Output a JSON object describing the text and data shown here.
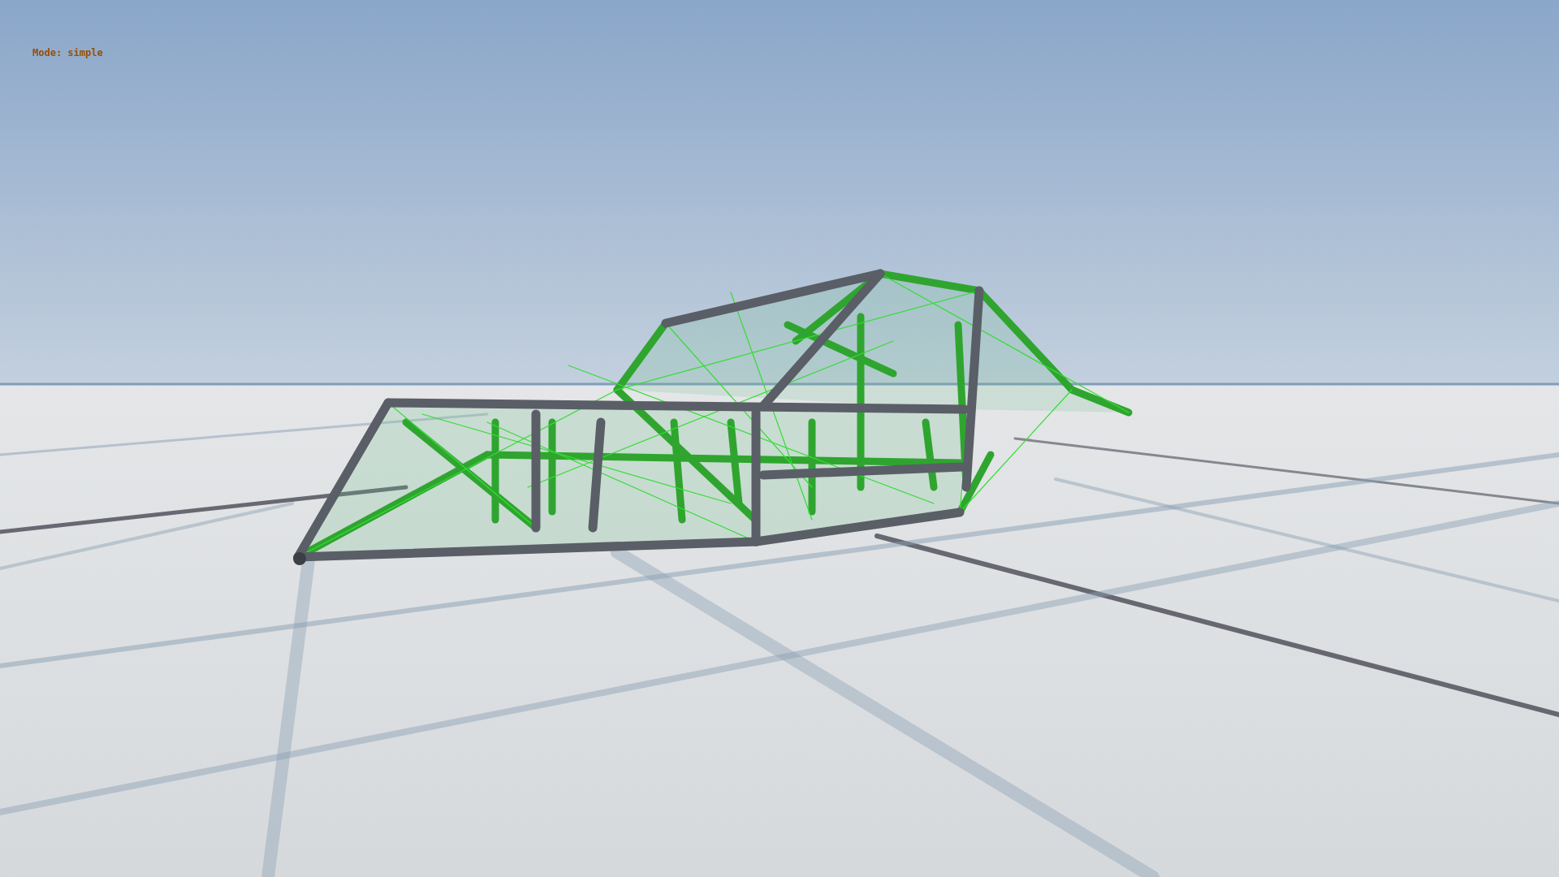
{
  "hud": {
    "mode_text": "Mode: simple"
  }
}
